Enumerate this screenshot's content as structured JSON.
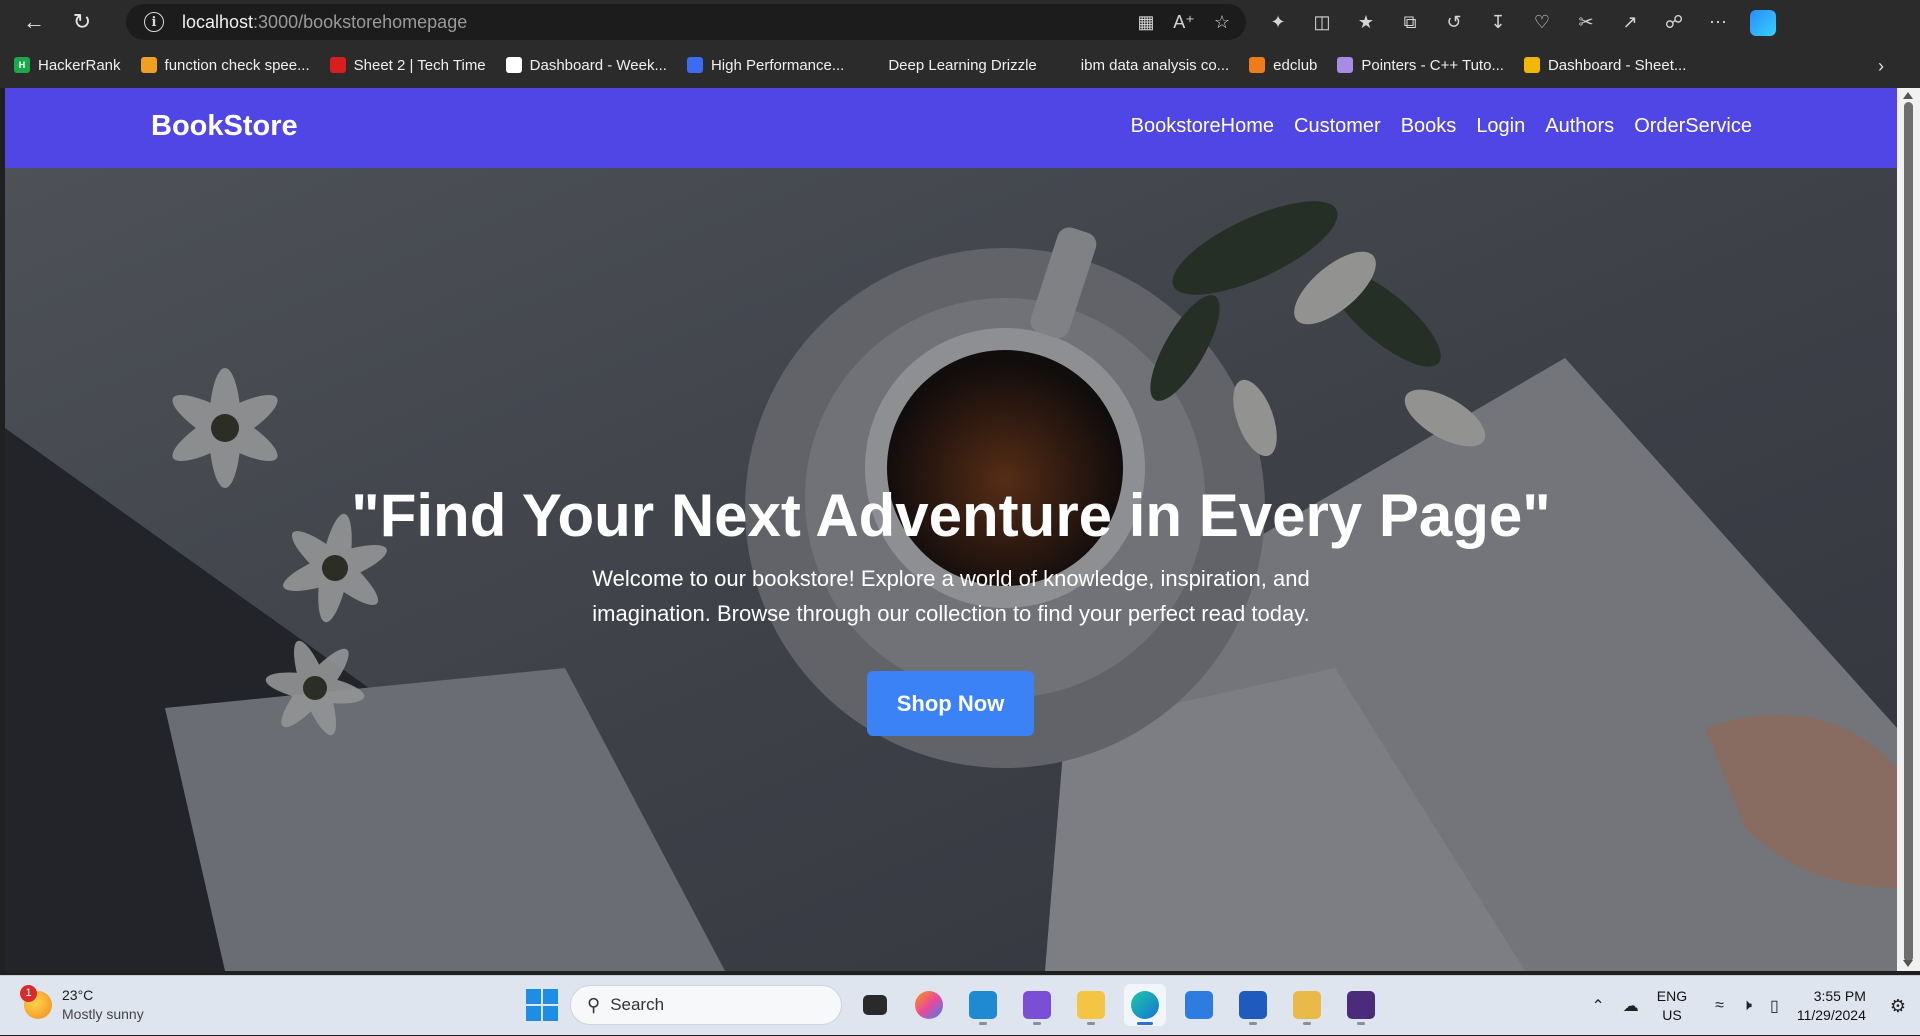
{
  "browser": {
    "url_host": "localhost",
    "url_path": ":3000/bookstorehomepage",
    "bookmarks": [
      {
        "label": "HackerRank",
        "color": "#1ba94c",
        "glyph": "H"
      },
      {
        "label": "function check spee...",
        "color": "#f0a020",
        "glyph": ""
      },
      {
        "label": "Sheet 2 | Tech Time",
        "color": "#d81e1e",
        "glyph": ""
      },
      {
        "label": "Dashboard - Week...",
        "color": "#ffffff",
        "glyph": ""
      },
      {
        "label": "High Performance...",
        "color": "#3b6cf5",
        "glyph": ""
      },
      {
        "label": "Deep Learning Drizzle",
        "color": "#2b2b2b",
        "glyph": ""
      },
      {
        "label": "ibm data analysis co...",
        "color": "#2b2b2b",
        "glyph": ""
      },
      {
        "label": "edclub",
        "color": "#f07b1a",
        "glyph": ""
      },
      {
        "label": "Pointers - C++ Tuto...",
        "color": "#a98be3",
        "glyph": ""
      },
      {
        "label": "Dashboard - Sheet...",
        "color": "#f2b705",
        "glyph": ""
      }
    ]
  },
  "site": {
    "brand": "BookStore",
    "nav": [
      "BookstoreHome",
      "Customer",
      "Books",
      "Login",
      "Authors",
      "OrderService"
    ],
    "hero": {
      "title": "\"Find Your Next Adventure in Every Page\"",
      "subtitle": "Welcome to our bookstore! Explore a world of knowledge, inspiration, and imagination. Browse through our collection to find your perfect read today.",
      "cta": "Shop Now"
    },
    "colors": {
      "nav_bg": "#4f46e5",
      "cta_bg": "#3b82f6"
    }
  },
  "taskbar": {
    "weather_temp": "23°C",
    "weather_condition": "Mostly sunny",
    "weather_badge": "1",
    "search_placeholder": "Search",
    "lang_1": "ENG",
    "lang_2": "US",
    "time": "3:55 PM",
    "date": "11/29/2024"
  }
}
